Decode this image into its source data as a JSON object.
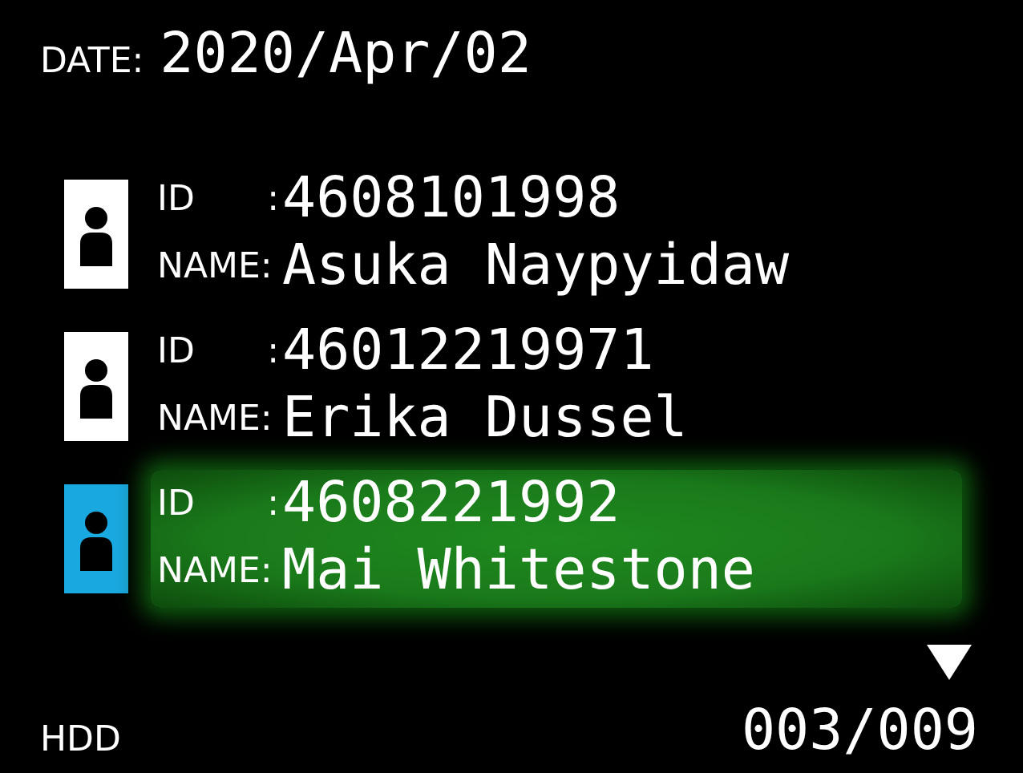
{
  "date": {
    "label": "DATE:",
    "value": "2020/Apr/02"
  },
  "records": [
    {
      "id_label": "ID",
      "id_separator": ":",
      "id": "4608101998",
      "name_label": "NAME:",
      "name": "Asuka Naypyidaw",
      "selected": false
    },
    {
      "id_label": "ID",
      "id_separator": ":",
      "id": "46012219971",
      "name_label": "NAME:",
      "name": "Erika Dussel",
      "selected": false
    },
    {
      "id_label": "ID",
      "id_separator": ":",
      "id": "4608221992",
      "name_label": "NAME:",
      "name": "Mai Whitestone",
      "selected": true
    }
  ],
  "footer": {
    "media": "HDD",
    "counter": "003/009"
  }
}
